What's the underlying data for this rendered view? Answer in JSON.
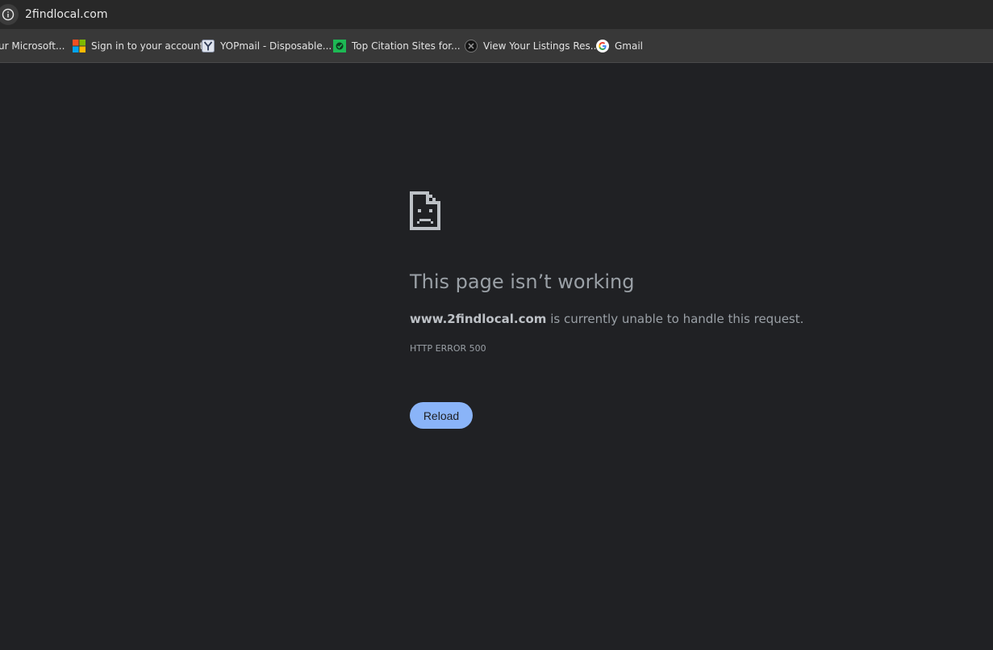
{
  "address_bar": {
    "url": "2findlocal.com",
    "info_icon": "info-icon"
  },
  "bookmarks": [
    {
      "label": "ur Microsoft...",
      "icon": "none"
    },
    {
      "label": "Sign in to your account",
      "icon": "microsoft-logo-icon"
    },
    {
      "label": "YOPmail - Disposable...",
      "icon": "yopmail-icon"
    },
    {
      "label": "Top Citation Sites for...",
      "icon": "citation-site-icon"
    },
    {
      "label": "View Your Listings Res...",
      "icon": "listings-site-icon"
    },
    {
      "label": "Gmail",
      "icon": "google-g-icon"
    }
  ],
  "error_page": {
    "icon": "sad-page-icon",
    "title": "This page isn’t working",
    "domain": "www.2findlocal.com",
    "message": " is currently unable to handle this request.",
    "error_code": "HTTP ERROR 500",
    "reload_label": "Reload"
  },
  "colors": {
    "page_background": "#202124",
    "text": "#9aa0a6",
    "button": "#8ab4f8",
    "bookmark_bar": "#383838",
    "address_bar": "#282828"
  }
}
